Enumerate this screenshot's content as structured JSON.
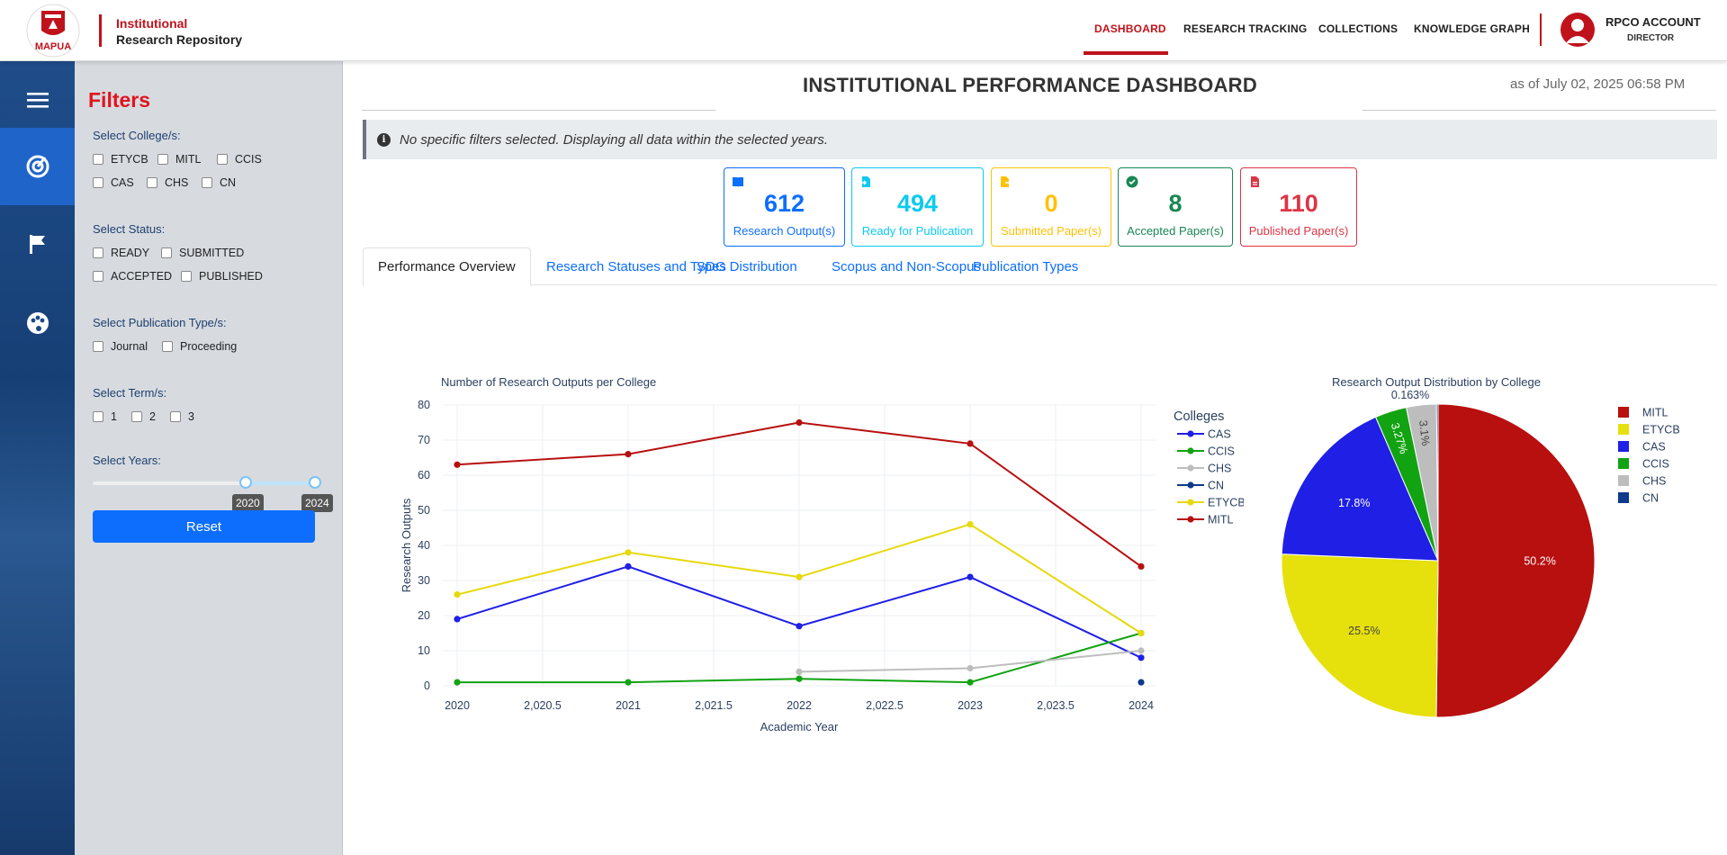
{
  "header": {
    "logo_text": "MAPUA",
    "brand_line1": "Institutional",
    "brand_line2": "Research Repository",
    "nav": [
      "DASHBOARD",
      "RESEARCH TRACKING",
      "COLLECTIONS",
      "KNOWLEDGE GRAPH"
    ],
    "account_name": "RPCO ACCOUNT",
    "account_role": "DIRECTOR"
  },
  "rail": {
    "icons": [
      "menu-icon",
      "dashboard-icon",
      "flag-icon",
      "palette-icon"
    ]
  },
  "filters": {
    "title": "Filters",
    "college_label": "Select College/s:",
    "colleges": [
      "ETYCB",
      "MITL",
      "CCIS",
      "CAS",
      "CHS",
      "CN"
    ],
    "status_label": "Select Status:",
    "statuses": [
      "READY",
      "SUBMITTED",
      "ACCEPTED",
      "PUBLISHED"
    ],
    "pubtype_label": "Select Publication Type/s:",
    "pubtypes": [
      "Journal",
      "Proceeding"
    ],
    "term_label": "Select Term/s:",
    "terms": [
      "1",
      "2",
      "3"
    ],
    "years_label": "Select Years:",
    "year_from": "2020",
    "year_to": "2024",
    "reset_label": "Reset"
  },
  "main": {
    "title": "INSTITUTIONAL PERFORMANCE DASHBOARD",
    "as_of": "as of July 02, 2025 06:58 PM",
    "notice": "No specific filters selected. Displaying all data within the selected years.",
    "cards": [
      {
        "value": "612",
        "label": "Research Output(s)",
        "color": "#0d6efd",
        "icon": "book-icon"
      },
      {
        "value": "494",
        "label": "Ready for Publication",
        "color": "#0dcaf0",
        "icon": "file-import-icon"
      },
      {
        "value": "0",
        "label": "Submitted Paper(s)",
        "color": "#ffc107",
        "icon": "file-export-icon"
      },
      {
        "value": "8",
        "label": "Accepted Paper(s)",
        "color": "#198754",
        "icon": "check-circle-icon"
      },
      {
        "value": "110",
        "label": "Published Paper(s)",
        "color": "#dc3545",
        "icon": "file-pdf-icon"
      }
    ],
    "tabs": [
      "Performance Overview",
      "Research Statuses and Types",
      "SDG Distribution",
      "Scopus and Non-Scopus",
      "Publication Types"
    ]
  },
  "chart_data": [
    {
      "type": "line",
      "title": "Number of Research Outputs per College",
      "xlabel": "Academic Year",
      "ylabel": "Research Outputs",
      "xlim": [
        2020,
        2024
      ],
      "ylim": [
        0,
        80
      ],
      "xticks": [
        "2020",
        "2,020.5",
        "2021",
        "2,021.5",
        "2022",
        "2,022.5",
        "2023",
        "2,023.5",
        "2024"
      ],
      "yticks": [
        "0",
        "10",
        "20",
        "30",
        "40",
        "50",
        "60",
        "70",
        "80"
      ],
      "legend_title": "Colleges",
      "legend_position": "right",
      "grid": true,
      "series": [
        {
          "name": "CAS",
          "color": "#1f1fe6",
          "x": [
            2020,
            2021,
            2022,
            2023,
            2024
          ],
          "values": [
            19,
            34,
            17,
            31,
            8
          ]
        },
        {
          "name": "CCIS",
          "color": "#12a312",
          "x": [
            2020,
            2021,
            2022,
            2023,
            2024
          ],
          "values": [
            1,
            1,
            2,
            1,
            15
          ]
        },
        {
          "name": "CHS",
          "color": "#bdbdbd",
          "x": [
            2022,
            2023,
            2024
          ],
          "values": [
            4,
            5,
            10
          ]
        },
        {
          "name": "CN",
          "color": "#0d3a8a",
          "x": [
            2024
          ],
          "values": [
            1
          ]
        },
        {
          "name": "ETYCB",
          "color": "#e6d90c",
          "x": [
            2020,
            2021,
            2022,
            2023,
            2024
          ],
          "values": [
            26,
            38,
            31,
            46,
            15
          ]
        },
        {
          "name": "MITL",
          "color": "#b80f0f",
          "x": [
            2020,
            2021,
            2022,
            2023,
            2024
          ],
          "values": [
            63,
            66,
            75,
            69,
            34
          ]
        }
      ]
    },
    {
      "type": "pie",
      "title": "Research Output Distribution by College",
      "legend_position": "right",
      "slices": [
        {
          "name": "MITL",
          "value": 50.2,
          "label": "50.2%",
          "color": "#b80f0f"
        },
        {
          "name": "ETYCB",
          "value": 25.5,
          "label": "25.5%",
          "color": "#e6e00c"
        },
        {
          "name": "CAS",
          "value": 17.8,
          "label": "17.8%",
          "color": "#1f1fe6"
        },
        {
          "name": "CCIS",
          "value": 3.27,
          "label": "3.27%",
          "color": "#12a312"
        },
        {
          "name": "CHS",
          "value": 3.1,
          "label": "3.1%",
          "color": "#bdbdbd"
        },
        {
          "name": "CN",
          "value": 0.163,
          "label": "0.163%",
          "color": "#0d3a8a"
        }
      ]
    }
  ]
}
